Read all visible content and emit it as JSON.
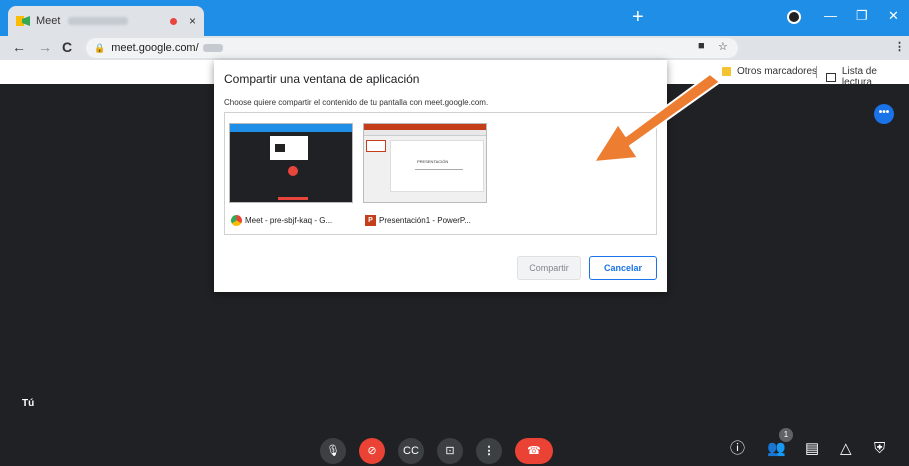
{
  "browser": {
    "tab_title": "Meet",
    "tab_close": "×",
    "new_tab": "+",
    "url": "meet.google.com",
    "url_separator": "/",
    "bookmarks": {
      "other": "Otros marcadores",
      "reading_list": "Lista de lectura"
    }
  },
  "dialog": {
    "title": "Compartir una ventana de aplicación",
    "subtitle": "Choose quiere compartir el contenido de tu pantalla con meet.google.com.",
    "windows": [
      {
        "label": "Meet - pre-sbjf-kaq - G..."
      },
      {
        "label": "Presentación1 - PowerP..."
      }
    ],
    "ppt_slide_title": "PRESENTACIÓN",
    "share_label": "Compartir",
    "cancel_label": "Cancelar"
  },
  "meet": {
    "you_label": "Tú",
    "participant_count": "1"
  },
  "colors": {
    "chrome_blue": "#1e8ee6",
    "meet_bg": "#202124",
    "accent": "#1a73e8",
    "red": "#ea4335",
    "arrow": "#ed7d31"
  },
  "icons": {
    "controls": [
      "mic-icon",
      "camera-off-icon",
      "captions-icon",
      "present-icon",
      "more-vert-icon",
      "hangup-icon"
    ],
    "right": [
      "info-icon",
      "people-icon",
      "chat-icon",
      "activities-icon",
      "host-controls-icon"
    ]
  }
}
